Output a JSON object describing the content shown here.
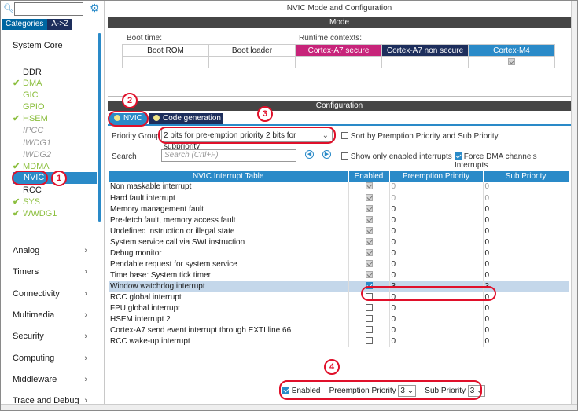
{
  "sidebar": {
    "search_value": "",
    "tabs": [
      "Categories",
      "A->Z"
    ],
    "section_title": "System Core",
    "items": [
      {
        "label": "DDR",
        "checked": false,
        "style": "black"
      },
      {
        "label": "DMA",
        "checked": true,
        "style": "green"
      },
      {
        "label": "GIC",
        "checked": false,
        "style": "green"
      },
      {
        "label": "GPIO",
        "checked": false,
        "style": "green"
      },
      {
        "label": "HSEM",
        "checked": true,
        "style": "green"
      },
      {
        "label": "IPCC",
        "checked": false,
        "style": "grey"
      },
      {
        "label": "IWDG1",
        "checked": false,
        "style": "grey"
      },
      {
        "label": "IWDG2",
        "checked": false,
        "style": "grey"
      },
      {
        "label": "MDMA",
        "checked": true,
        "style": "green"
      },
      {
        "label": "NVIC",
        "checked": false,
        "style": "selected"
      },
      {
        "label": "RCC",
        "checked": false,
        "style": "black"
      },
      {
        "label": "SYS",
        "checked": true,
        "style": "green"
      },
      {
        "label": "WWDG1",
        "checked": true,
        "style": "green"
      }
    ],
    "categories": [
      "Analog",
      "Timers",
      "Connectivity",
      "Multimedia",
      "Security",
      "Computing",
      "Middleware",
      "Trace and Debug"
    ]
  },
  "main": {
    "window_title": "NVIC Mode and Configuration",
    "mode_header": "Mode",
    "boot_time_label": "Boot time:",
    "runtime_label": "Runtime contexts:",
    "mode_columns": [
      {
        "label": "Boot ROM",
        "bg": "#ffffff",
        "fg": "#222222"
      },
      {
        "label": "Boot loader",
        "bg": "#ffffff",
        "fg": "#222222"
      },
      {
        "label": "Cortex-A7 secure",
        "bg": "#c7247a",
        "fg": "#ffffff"
      },
      {
        "label": "Cortex-A7 non secure",
        "bg": "#1d2e5c",
        "fg": "#ffffff"
      },
      {
        "label": "Cortex-M4",
        "bg": "#2a8ac8",
        "fg": "#ffffff"
      }
    ],
    "configuration_header": "Configuration",
    "config_tabs": [
      "NVIC",
      "Code generation"
    ],
    "priority_group_label": "Priority Group",
    "priority_group_value": "2 bits for pre-emption priority 2 bits for subpriority",
    "sort_label": "Sort by Premption Priority and Sub Priority",
    "search_label": "Search",
    "search_placeholder": "Search (Crtl+F)",
    "show_enabled_label": "Show only enabled interrupts",
    "force_dma_label": "Force DMA channels Interrupts",
    "table_headers": [
      "NVIC Interrupt Table",
      "Enabled",
      "Preemption Priority",
      "Sub Priority"
    ],
    "rows": [
      {
        "name": "Non maskable interrupt",
        "enabled": "fixed",
        "pre": "0",
        "sub": "0",
        "grey": true
      },
      {
        "name": "Hard fault interrupt",
        "enabled": "fixed",
        "pre": "0",
        "sub": "0",
        "grey": true
      },
      {
        "name": "Memory management fault",
        "enabled": "fixed",
        "pre": "0",
        "sub": "0",
        "grey": false
      },
      {
        "name": "Pre-fetch fault, memory access fault",
        "enabled": "fixed",
        "pre": "0",
        "sub": "0",
        "grey": false
      },
      {
        "name": "Undefined instruction or illegal state",
        "enabled": "fixed",
        "pre": "0",
        "sub": "0",
        "grey": false
      },
      {
        "name": "System service call via SWI instruction",
        "enabled": "fixed",
        "pre": "0",
        "sub": "0",
        "grey": false
      },
      {
        "name": "Debug monitor",
        "enabled": "fixed",
        "pre": "0",
        "sub": "0",
        "grey": false
      },
      {
        "name": "Pendable request for system service",
        "enabled": "fixed",
        "pre": "0",
        "sub": "0",
        "grey": false
      },
      {
        "name": "Time base: System tick timer",
        "enabled": "fixed",
        "pre": "0",
        "sub": "0",
        "grey": false
      },
      {
        "name": "Window watchdog interrupt",
        "enabled": "on",
        "pre": "3",
        "sub": "3",
        "grey": false,
        "selected": true
      },
      {
        "name": "RCC global interrupt",
        "enabled": "off",
        "pre": "0",
        "sub": "0",
        "grey": false
      },
      {
        "name": "FPU global interrupt",
        "enabled": "off",
        "pre": "0",
        "sub": "0",
        "grey": false
      },
      {
        "name": "HSEM interrupt 2",
        "enabled": "off",
        "pre": "0",
        "sub": "0",
        "grey": false
      },
      {
        "name": "Cortex-A7 send event interrupt through EXTI line 66",
        "enabled": "off",
        "pre": "0",
        "sub": "0",
        "grey": false
      },
      {
        "name": "RCC wake-up interrupt",
        "enabled": "off",
        "pre": "0",
        "sub": "0",
        "grey": false
      }
    ],
    "bottom": {
      "enabled_label": "Enabled",
      "preemption_label": "Preemption Priority",
      "preemption_value": "3",
      "sub_label": "Sub Priority",
      "sub_value": "3"
    }
  },
  "annotations": [
    "1",
    "2",
    "3",
    "4"
  ],
  "colors": {
    "accent": "#2a8ac8",
    "annotation": "#e0102a",
    "green_item": "#8cbf3f"
  }
}
